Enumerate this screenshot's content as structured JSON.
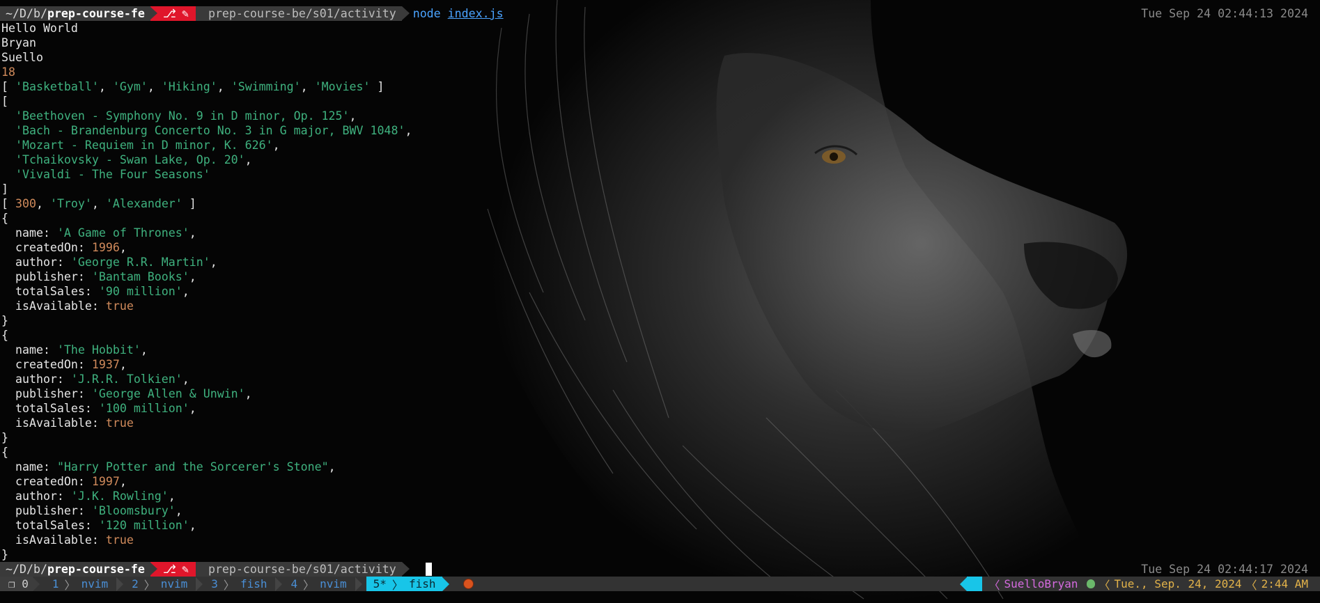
{
  "colors": {
    "string": "#3fb27f",
    "number": "#d08a5b",
    "accent_red": "#e0162b",
    "accent_cyan": "#18c5e8",
    "command_blue": "#4aa3ff"
  },
  "prompt_top": {
    "dir_prefix": "~/D/b/",
    "dir_bold": "prep-course-fe",
    "git_icons": "branch-icon pencil-icon",
    "path": "prep-course-be/s01/activity",
    "command": "node",
    "command_arg": "index.js",
    "timestamp": "Tue Sep 24 02:44:13 2024"
  },
  "output": {
    "line1": "Hello World",
    "line2": "Bryan",
    "line3": "Suello",
    "age": "18",
    "hobbies": [
      "'Basketball'",
      "'Gym'",
      "'Hiking'",
      "'Swimming'",
      "'Movies'"
    ],
    "music": [
      "'Beethoven - Symphony No. 9 in D minor, Op. 125'",
      "'Bach - Brandenburg Concerto No. 3 in G major, BWV 1048'",
      "'Mozart - Requiem in D minor, K. 626'",
      "'Tchaikovsky - Swan Lake, Op. 20'",
      "'Vivaldi - The Four Seasons'"
    ],
    "mixed_array": {
      "num": "300",
      "s1": "'Troy'",
      "s2": "'Alexander'"
    },
    "books": [
      {
        "name": "'A Game of Thrones'",
        "createdOn": "1996",
        "author": "'George R.R. Martin'",
        "publisher": "'Bantam Books'",
        "totalSales": "'90 million'",
        "isAvailable": "true"
      },
      {
        "name": "'The Hobbit'",
        "createdOn": "1937",
        "author": "'J.R.R. Tolkien'",
        "publisher": "'George Allen & Unwin'",
        "totalSales": "'100 million'",
        "isAvailable": "true"
      },
      {
        "name": "\"Harry Potter and the Sorcerer's Stone\"",
        "createdOn": "1997",
        "author": "'J.K. Rowling'",
        "publisher": "'Bloomsbury'",
        "totalSales": "'120 million'",
        "isAvailable": "true"
      }
    ]
  },
  "prompt_bottom": {
    "dir_prefix": "~/D/b/",
    "dir_bold": "prep-course-fe",
    "path": "prep-course-be/s01/activity",
    "timestamp": "Tue Sep 24 02:44:17 2024"
  },
  "statusbar": {
    "session": "❐ 0",
    "windows": [
      {
        "index": "1",
        "name": "nvim",
        "active": false
      },
      {
        "index": "2",
        "name": "nvim",
        "active": false
      },
      {
        "index": "3",
        "name": "fish",
        "active": false
      },
      {
        "index": "4",
        "name": "nvim",
        "active": false
      },
      {
        "index": "5*",
        "name": "fish",
        "active": true
      }
    ],
    "user": "SuelloBryan",
    "date": "Tue., Sep. 24, 2024",
    "time": "2:44 AM"
  }
}
